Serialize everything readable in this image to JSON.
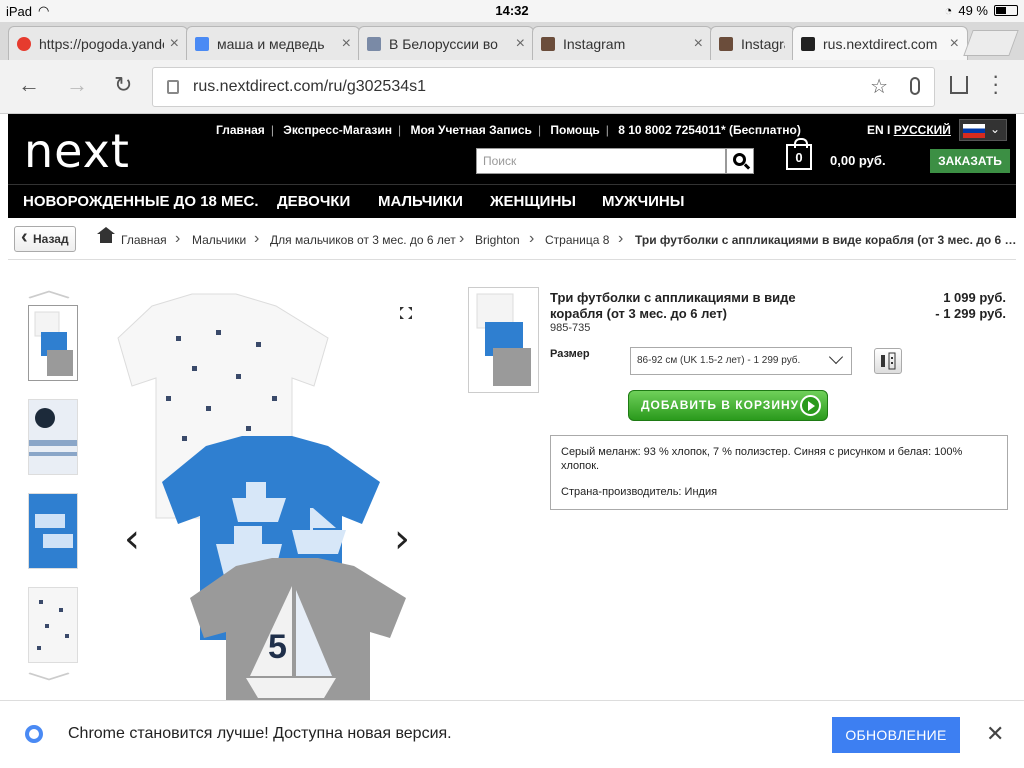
{
  "status": {
    "device": "iPad",
    "time": "14:32",
    "battery": "49 %"
  },
  "tabs": [
    {
      "title": "https://pogoda.yandex",
      "favicon_color": "#e63b2e"
    },
    {
      "title": "маша и медведь",
      "favicon_color": "#4a8af4"
    },
    {
      "title": "В Белоруссии во",
      "favicon_color": "#7a8aa6"
    },
    {
      "title": "Instagram",
      "favicon_color": "#6b4d3b"
    },
    {
      "title": "Instagram",
      "favicon_color": "#6b4d3b"
    },
    {
      "title": "rus.nextdirect.com",
      "favicon_color": "#222222"
    }
  ],
  "address": {
    "url": "rus.nextdirect.com/ru/g302534s1"
  },
  "site": {
    "logo": "next",
    "toplinks": [
      "Главная",
      "Экспресс-Магазин",
      "Моя Учетная Запись",
      "Помощь",
      "8 10 8002 7254011* (Бесплатно)"
    ],
    "lang_en": "EN I",
    "lang_ru": "РУССКИЙ",
    "search_placeholder": "Поиск",
    "bag_count": "0",
    "bag_total": "0,00 руб.",
    "order_label": "ЗАКАЗАТЬ",
    "categories": [
      "НОВОРОЖДЕННЫЕ ДО 18 МЕС.",
      "ДЕВОЧКИ",
      "МАЛЬЧИКИ",
      "ЖЕНЩИНЫ",
      "МУЖЧИНЫ"
    ]
  },
  "breadcrumbs": {
    "back_label": "Назад",
    "items": [
      "Главная",
      "Мальчики",
      "Для мальчиков от 3 мес. до 6 лет",
      "Brighton",
      "Страница 8",
      "Три футболки с аппликациями в виде корабля (от 3 мес. до 6 …"
    ]
  },
  "product": {
    "title": "Три футболки с аппликациями в виде корабля (от 3 мес. до 6 лет)",
    "code": "985-735",
    "price_line1": "1 099 руб.",
    "price_line2": "- 1 299 руб.",
    "size_label": "Размер",
    "size_value": "86-92 см (UK 1.5-2 лет) - 1 299 руб.",
    "add_to_cart": "ДОБАВИТЬ В КОРЗИНУ",
    "description": "Серый меланж: 93 % хлопок, 7 % полиэстер. Синяя с рисунком и белая: 100% хлопок.",
    "country": "Страна-производитель: Индия"
  },
  "banner": {
    "message": "Chrome становится лучше! Доступна новая версия.",
    "button": "ОБНОВЛЕНИЕ"
  },
  "colors": {
    "order_green": "#3c8f44",
    "update_blue": "#3d7ff2",
    "tee_blue": "#2f7fd0",
    "tee_grey": "#9a9a9a"
  }
}
